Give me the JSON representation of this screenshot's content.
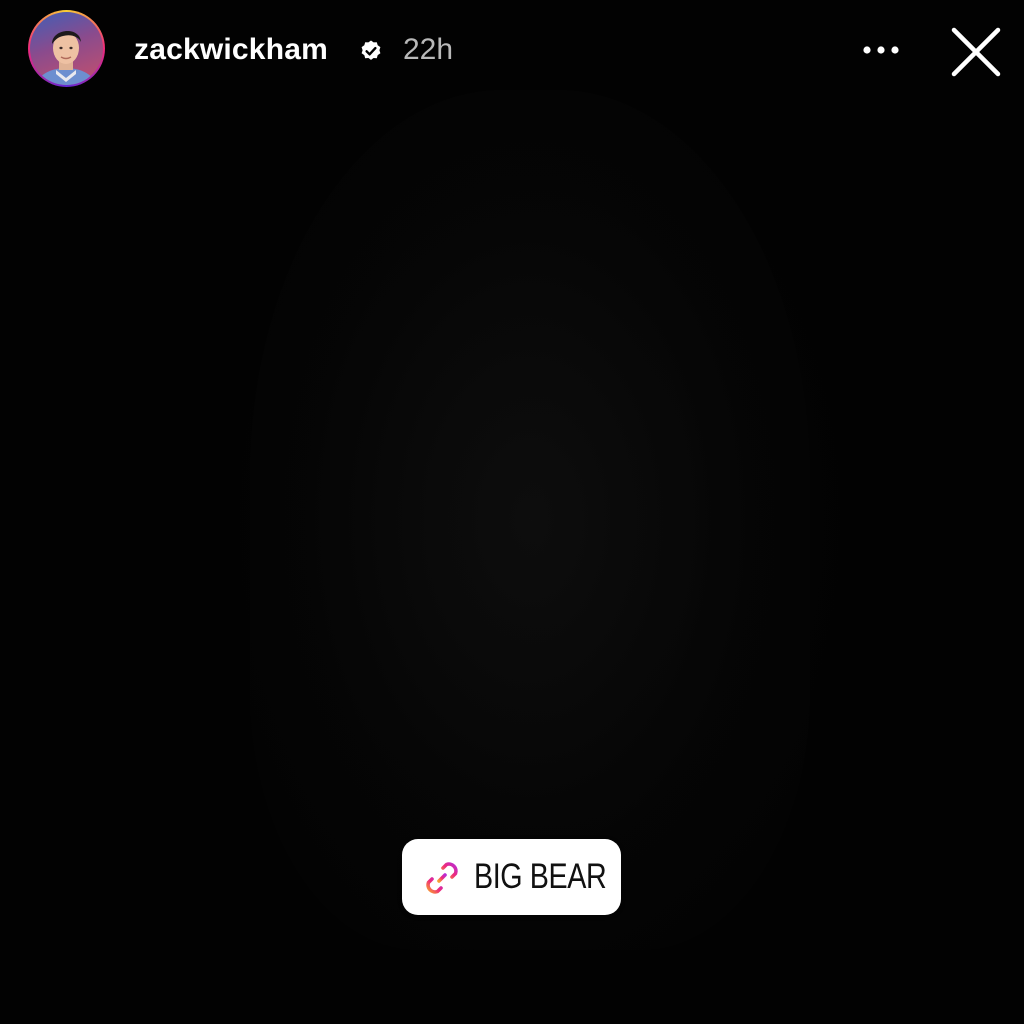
{
  "story": {
    "author": {
      "username": "zackwickham",
      "verified_icon": "verified-badge-icon",
      "avatar": "profile-photo"
    },
    "posted_ago": "22h",
    "controls": {
      "more_icon": "more-horizontal-icon",
      "close_icon": "close-icon"
    },
    "link_sticker": {
      "icon": "link-icon",
      "label": "BIG BEAR"
    }
  },
  "colors": {
    "background": "#000000",
    "text_primary": "#ffffff",
    "text_secondary": "#b9b9b9",
    "sticker_background": "#ffffff",
    "link_gradient_start": "#f9a030",
    "link_gradient_mid": "#ee2a7b",
    "link_gradient_end": "#b92bd6"
  }
}
